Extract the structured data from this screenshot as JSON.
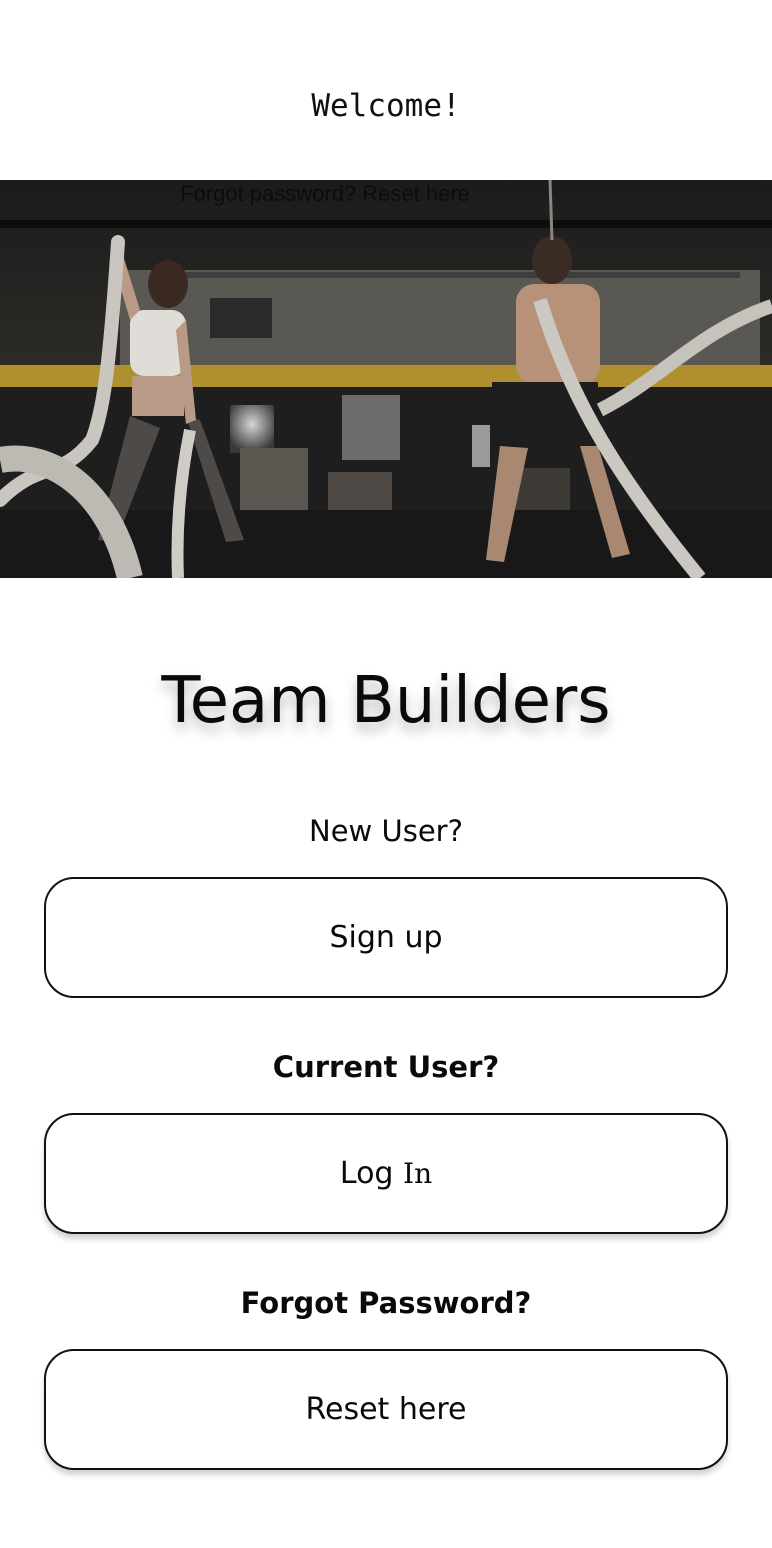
{
  "header": {
    "welcome": "Welcome!"
  },
  "hero": {
    "overlay_text": "Forgot password? Reset here",
    "image_desc": "gym-battle-ropes-photo"
  },
  "brand": {
    "title": "Team Builders"
  },
  "sections": {
    "new_user": {
      "label": "New User?",
      "button": "Sign up"
    },
    "current_user": {
      "label": "Current User?",
      "button_part1": "Log ",
      "button_part2": "In"
    },
    "forgot": {
      "label": "Forgot Password?",
      "button": "Reset here"
    }
  },
  "colors": {
    "text": "#0a0a0a",
    "border": "#111111",
    "background": "#ffffff"
  }
}
